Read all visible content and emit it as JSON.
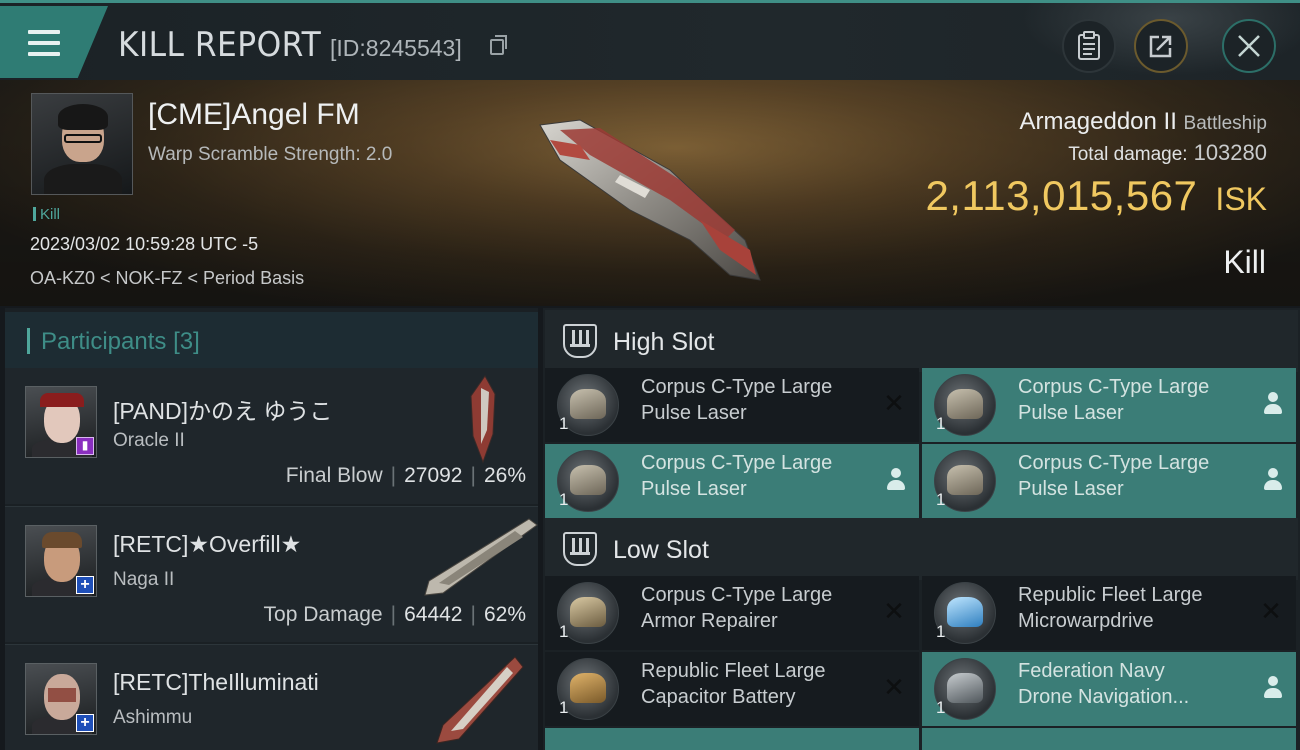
{
  "header": {
    "title": "KILL REPORT",
    "report_id": "[ID:8245543]"
  },
  "victim": {
    "name": "[CME]Angel FM",
    "warp_scramble": "Warp Scramble Strength: 2.0",
    "tag": "Kill",
    "datetime": "2023/03/02 10:59:28 UTC -5",
    "location": "OA-KZ0 < NOK-FZ < Period Basis",
    "ship_name": "Armageddon II",
    "ship_class": "Battleship",
    "total_damage_label": "Total damage:",
    "total_damage": "103280",
    "isk_value": "2,113,015,567",
    "isk_currency": "ISK",
    "result": "Kill"
  },
  "participants": {
    "label": "Participants",
    "count": "[3]",
    "items": [
      {
        "name": "[PAND]かのえ ゆうこ",
        "ship": "Oracle II",
        "role": "Final Blow",
        "damage": "27092",
        "percent": "26%"
      },
      {
        "name": "[RETC]★Overfill★",
        "ship": "Naga II",
        "role": "Top Damage",
        "damage": "64442",
        "percent": "62%"
      },
      {
        "name": "[RETC]TheIlluminati",
        "ship": "Ashimmu",
        "role": "",
        "damage": "",
        "percent": ""
      }
    ]
  },
  "slots": {
    "high": {
      "label": "High Slot",
      "modules": [
        {
          "qty": "1",
          "line1": "Corpus C-Type Large",
          "line2": "Pulse Laser",
          "state": "destroyed"
        },
        {
          "qty": "1",
          "line1": "Corpus C-Type Large",
          "line2": "Pulse Laser",
          "state": "dropped"
        },
        {
          "qty": "1",
          "line1": "Corpus C-Type Large",
          "line2": "Pulse Laser",
          "state": "dropped"
        },
        {
          "qty": "1",
          "line1": "Corpus C-Type Large",
          "line2": "Pulse Laser",
          "state": "dropped"
        }
      ]
    },
    "low": {
      "label": "Low Slot",
      "modules": [
        {
          "qty": "1",
          "line1": "Corpus C-Type Large",
          "line2": "Armor Repairer",
          "state": "destroyed"
        },
        {
          "qty": "1",
          "line1": "Republic Fleet Large",
          "line2": "Microwarpdrive",
          "state": "destroyed"
        },
        {
          "qty": "1",
          "line1": "Republic Fleet Large",
          "line2": "Capacitor Battery",
          "state": "destroyed"
        },
        {
          "qty": "1",
          "line1": "Federation Navy",
          "line2": "Drone Navigation...",
          "state": "dropped"
        }
      ]
    }
  },
  "colors": {
    "accent": "#3b7d77",
    "isk": "#f0c860"
  },
  "icons": {
    "menu": "hamburger-icon",
    "copy": "copy-icon",
    "clipboard": "clipboard-icon",
    "share": "share-icon",
    "close": "close-icon",
    "destroyed": "x-icon",
    "dropped": "person-icon"
  }
}
